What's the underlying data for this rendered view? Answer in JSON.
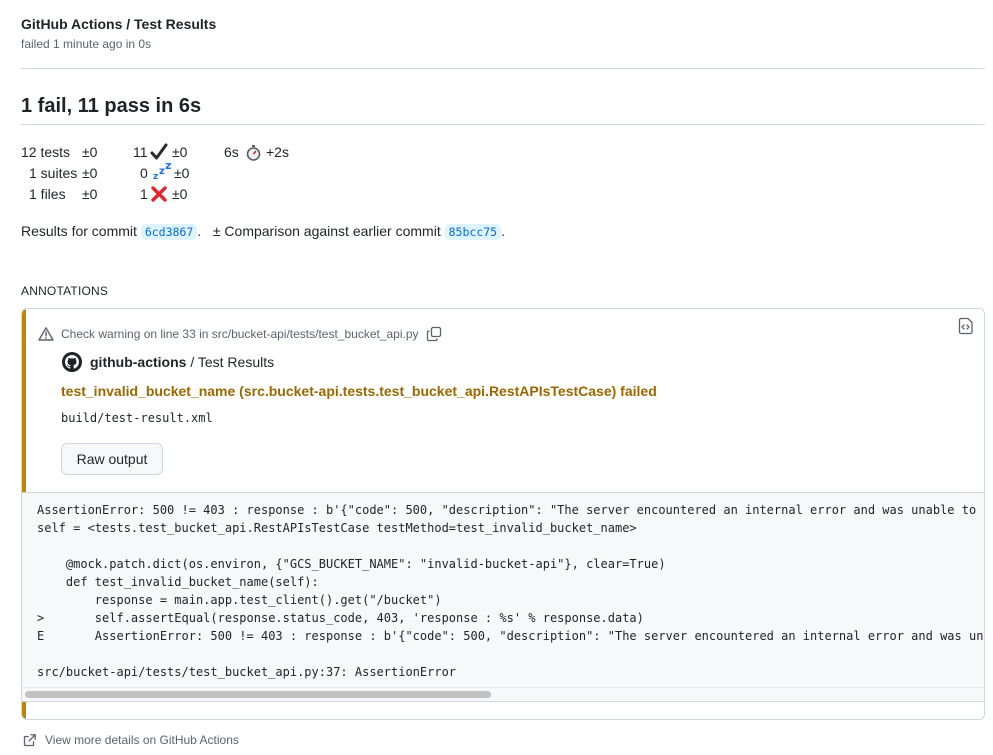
{
  "header": {
    "title": "GitHub Actions / Test Results",
    "subtitle": "failed 1 minute ago in 0s"
  },
  "summary": {
    "title": "1 fail, 11 pass in 6s"
  },
  "stats": {
    "tests": "12 tests",
    "tests_delta": "±0",
    "suites": "1 suites",
    "suites_delta": "±0",
    "files": "1 files",
    "files_delta": "±0",
    "passed": "11",
    "passed_icon": "check-mark-icon",
    "passed_delta": "±0",
    "skipped": "0",
    "skipped_icon": "zzz-icon",
    "skipped_delta": "±0",
    "failed": "1",
    "failed_icon": "cross-mark-icon",
    "failed_delta": "±0",
    "duration": "6s",
    "duration_icon": "stopwatch-icon",
    "duration_delta": "+2s"
  },
  "commit": {
    "prefix": "Results for commit",
    "sha": "6cd3867",
    "dot": ".",
    "comparison": "± Comparison against earlier commit",
    "earlier_sha": "85bcc75",
    "dot2": "."
  },
  "annotations": {
    "label": "ANNOTATIONS",
    "warning_text": "Check warning on line 33 in src/bucket-api/tests/test_bucket_api.py",
    "actor": "github-actions",
    "actor_suffix": " / Test Results",
    "title": "test_invalid_bucket_name (src.bucket-api.tests.test_bucket_api.RestAPIsTestCase) failed",
    "file": "build/test-result.xml",
    "raw_button": "Raw output",
    "accent_color": "#bf8700",
    "code": "AssertionError: 500 != 403 : response : b'{\"code\": 500, \"description\": \"The server encountered an internal error and was unable to\nself = <tests.test_bucket_api.RestAPIsTestCase testMethod=test_invalid_bucket_name>\n\n    @mock.patch.dict(os.environ, {\"GCS_BUCKET_NAME\": \"invalid-bucket-api\"}, clear=True)\n    def test_invalid_bucket_name(self):\n        response = main.app.test_client().get(\"/bucket\")\n>       self.assertEqual(response.status_code, 403, 'response : %s' % response.data)\nE       AssertionError: 500 != 403 : response : b'{\"code\": 500, \"description\": \"The server encountered an internal error and was un\n\nsrc/bucket-api/tests/test_bucket_api.py:37: AssertionError"
  },
  "footer": {
    "link": "View more details on GitHub Actions"
  }
}
